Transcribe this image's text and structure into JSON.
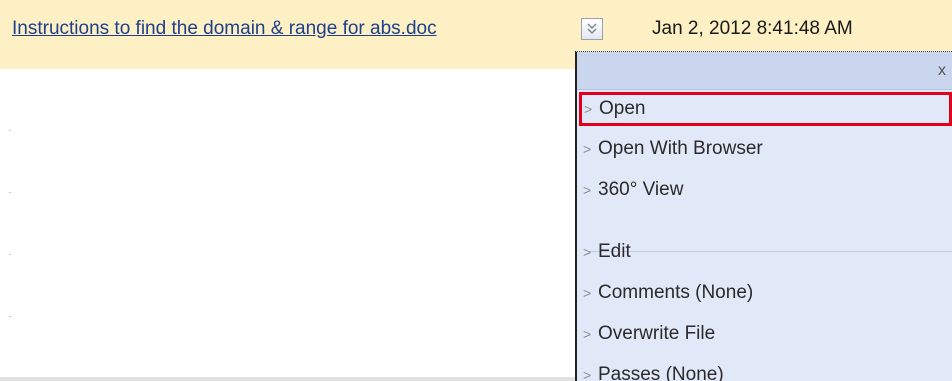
{
  "file": {
    "name": "Instructions to find the domain & range for abs.doc",
    "date": "Jan 2, 2012 8:41:48 AM"
  },
  "menu": {
    "close_label": "x",
    "arrow_glyph": ">",
    "items": [
      {
        "label": "Open",
        "selected": true
      },
      {
        "label": "Open With Browser"
      },
      {
        "label": "360° View"
      },
      {
        "label": "Edit"
      },
      {
        "label": "Comments (None)"
      },
      {
        "label": "Overwrite File"
      },
      {
        "label": "Passes (None)"
      }
    ]
  },
  "colors": {
    "row_highlight": "#fcf0c4",
    "menu_background": "#e1e9f8",
    "selection_border": "#e2001a",
    "link": "#1f3f8c"
  }
}
